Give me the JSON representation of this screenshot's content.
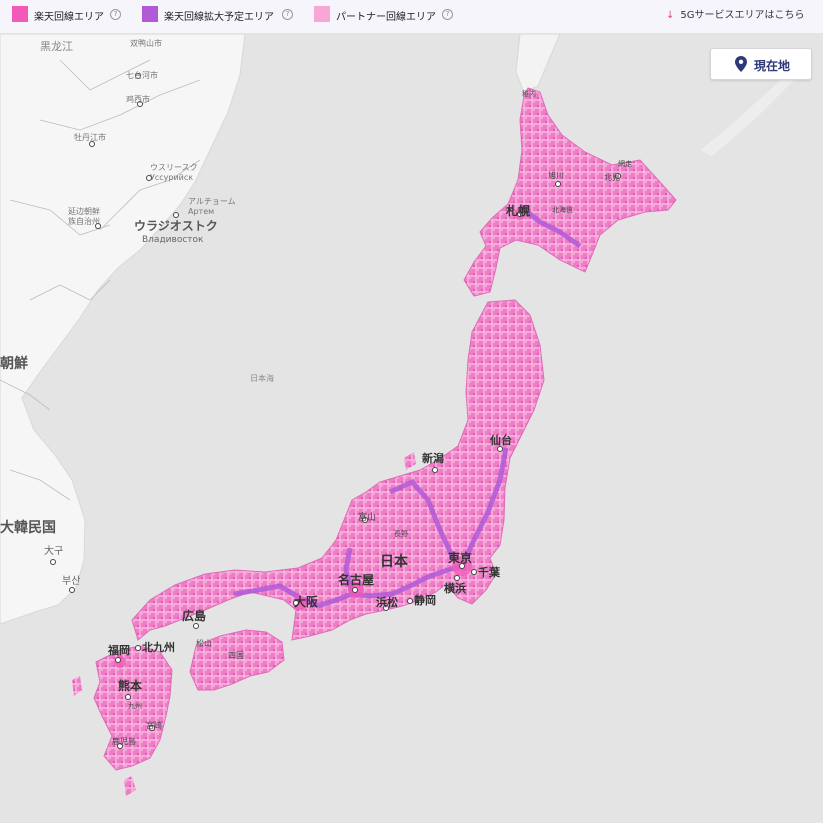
{
  "legend": {
    "items": [
      {
        "label": "楽天回線エリア",
        "color": "#f25ab8"
      },
      {
        "label": "楽天回線拡大予定エリア",
        "color": "#b05ad8"
      },
      {
        "label": "パートナー回線エリア",
        "color": "#f7a6d6"
      }
    ],
    "help_icon": "help-circle-icon",
    "fiveg_link": "5Gサービスエリアはこちら",
    "fiveg_icon": "arrow-down-icon"
  },
  "current_location": {
    "label": "現在地",
    "icon": "map-pin-icon"
  },
  "map": {
    "labels": {
      "heilongjiang": "黑龙江",
      "shuangyashan": "双鸭山市",
      "qitaihe": "七台河市",
      "jixi": "鸡西市",
      "mudanjiang": "牡丹江市",
      "ussuriysk_ja": "ウスリースク",
      "ussuriysk_ru": "Уссурийск",
      "artyom_ja": "アルチョーム",
      "artyom_ru": "Артем",
      "yanbian_1": "延边朝鲜",
      "yanbian_2": "族自治州",
      "vladivostok_ja": "ウラジオストク",
      "vladivostok_ru": "Владивосток",
      "north_korea": "朝鮮",
      "sea_of_japan": "日本海",
      "korea": "大韓民国",
      "daegu": "大구",
      "busan": "부산",
      "wakkanai": "稚内",
      "asahikawa": "旭川",
      "abashiri": "網走",
      "kitami": "北見",
      "sapporo": "札幌",
      "hokkaido": "北海道",
      "sendai": "仙台",
      "niigata": "新潟",
      "toyama": "富山",
      "nagano": "長野",
      "japan": "日本",
      "tokyo": "東京",
      "chiba": "千葉",
      "yokohama": "横浜",
      "shizuoka": "静岡",
      "hamamatsu": "浜松",
      "nagoya": "名古屋",
      "osaka": "大阪",
      "hiroshima": "広島",
      "matsuyama": "松山",
      "shikoku": "四国",
      "kitakyushu": "北九州",
      "fukuoka": "福岡",
      "kumamoto": "熊本",
      "kyushu": "九州",
      "miyazaki": "宮崎",
      "kagoshima": "鹿児島"
    }
  }
}
